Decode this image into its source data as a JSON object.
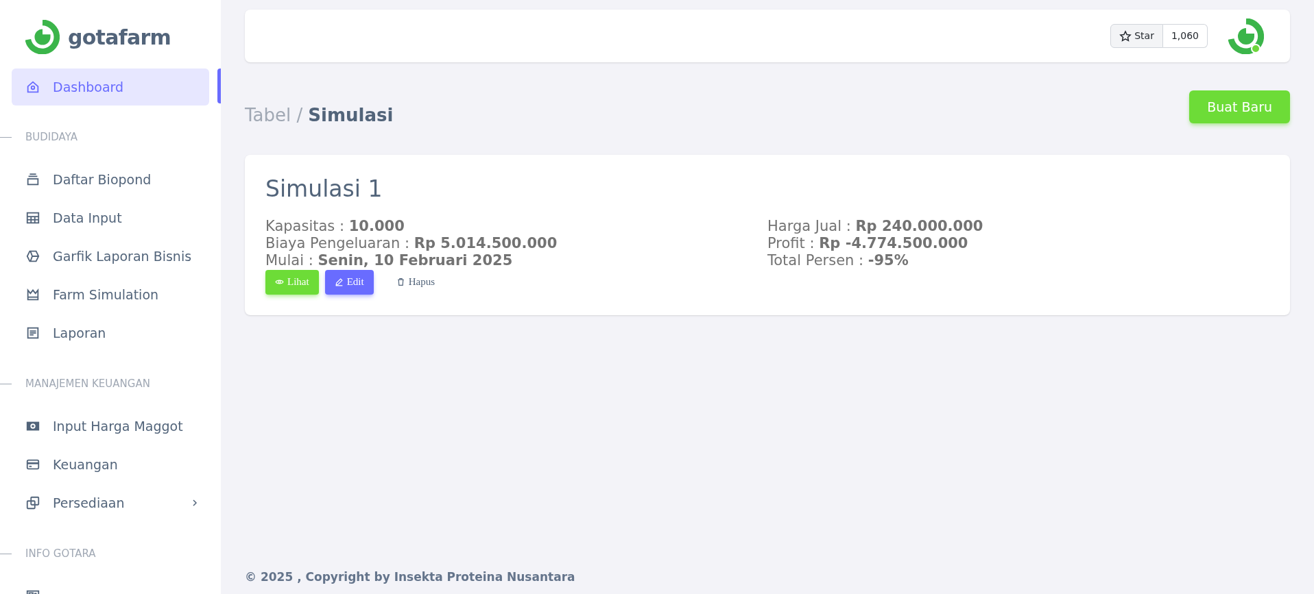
{
  "sidebar": {
    "logo": "gotafarm",
    "top_items": [
      {
        "label": "Dashboard",
        "kind": "home",
        "selected": true
      }
    ],
    "sections": [
      {
        "title": "BUDIDAYA",
        "items": [
          {
            "label": "Daftar Biopond",
            "kind": "stack",
            "selected": false
          },
          {
            "label": "Data Input",
            "kind": "table",
            "selected": false
          },
          {
            "label": "Garfik Laporan Bisnis",
            "kind": "hexagon",
            "selected": false
          },
          {
            "label": "Farm Simulation",
            "kind": "crown",
            "selected": false
          },
          {
            "label": "Laporan",
            "kind": "doc",
            "selected": false
          }
        ]
      },
      {
        "title": "MANAJEMEN KEUANGAN",
        "items": [
          {
            "label": "Input Harga Maggot",
            "kind": "cash",
            "selected": false
          },
          {
            "label": "Keuangan",
            "kind": "card",
            "selected": false
          },
          {
            "label": "Persediaan",
            "kind": "copy",
            "selected": false,
            "expanded": false
          }
        ]
      },
      {
        "title": "INFO GOTARA",
        "items": [
          {
            "kind": "news",
            "selected": false
          }
        ]
      }
    ]
  },
  "header": {
    "star_label": "Star",
    "star_count": "1,060"
  },
  "breadcrumb": {
    "parent": "Tabel /",
    "current": "Simulasi"
  },
  "create_button": "Buat Baru",
  "simulations": [
    {
      "title": "Simulasi 1",
      "left": [
        "Kapasitas : **10.000**",
        "Biaya Pengeluaran : **Rp 5.014.500.000**",
        "Mulai : **Senin, 10 Februari 2025**"
      ],
      "right": [
        "Harga Jual : **Rp 240.000.000**",
        "Profit : **Rp -4.774.500.000**",
        "Total Persen : **-95%**"
      ],
      "actions": [
        {
          "kind": "view",
          "label": "Lihat"
        },
        {
          "kind": "edit",
          "label": "Edit"
        },
        {
          "kind": "delete",
          "label": "Hapus"
        }
      ]
    }
  ],
  "footer": "© 2025 , Copyright by Insekta Proteina Nusantara"
}
